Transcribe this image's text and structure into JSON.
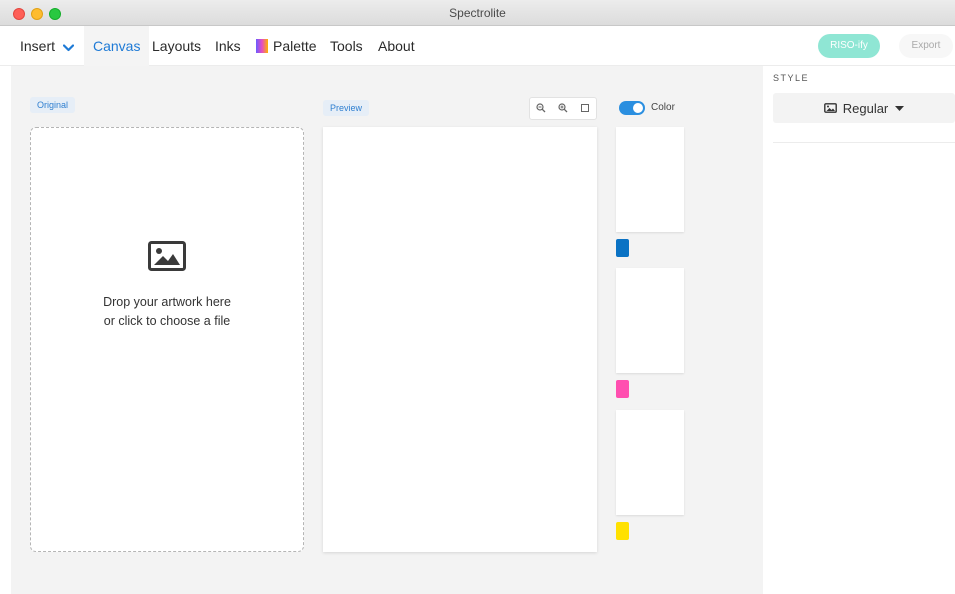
{
  "window": {
    "title": "Spectrolite"
  },
  "nav": {
    "insert": "Insert",
    "canvas": "Canvas",
    "layouts": "Layouts",
    "inks": "Inks",
    "palette": "Palette",
    "tools": "Tools",
    "about": "About",
    "riso_button": "RISO-ify",
    "export_button": "Export",
    "active_tab": "Canvas"
  },
  "canvas": {
    "original_label": "Original",
    "preview_label": "Preview",
    "drop_line1": "Drop your artwork here",
    "drop_line2": "or click to choose a file",
    "color_toggle_label": "Color",
    "color_toggle_on": true,
    "zoom_buttons": [
      "zoom-out-icon",
      "zoom-in-icon",
      "fit-icon"
    ]
  },
  "layers": [
    {
      "ink_color": "#0a72c4"
    },
    {
      "ink_color": "#ff4fb0"
    },
    {
      "ink_color": "#ffe100"
    }
  ],
  "side_panel": {
    "style_heading": "STYLE",
    "style_value": "Regular"
  },
  "colors": {
    "accent": "#1e7ad6",
    "riso_button": "#8fe6d4",
    "toggle": "#2b8fe0"
  }
}
